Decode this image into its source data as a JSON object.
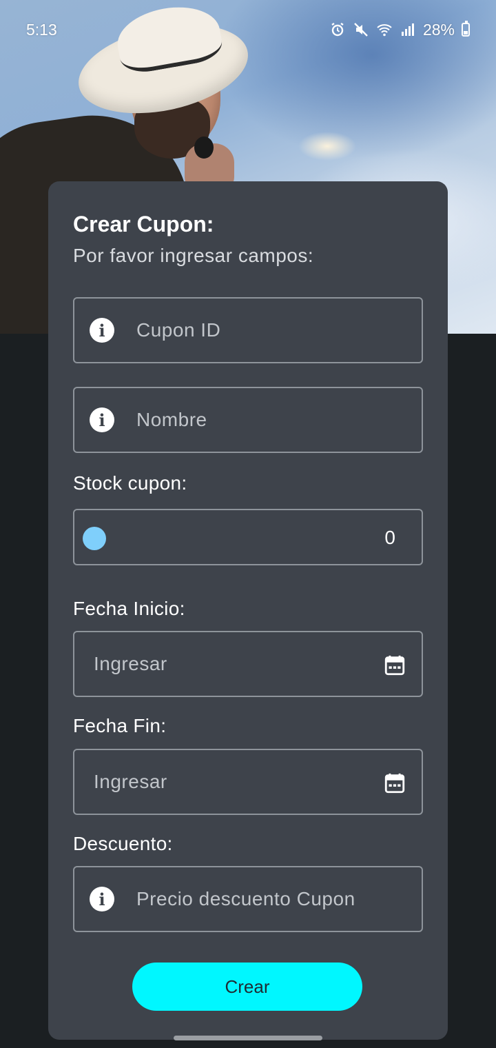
{
  "status_bar": {
    "time": "5:13",
    "battery": "28%",
    "icons": [
      "alarm-icon",
      "mute-icon",
      "wifi-icon",
      "signal-icon",
      "battery-icon"
    ]
  },
  "hero": {
    "image": "performer-photo"
  },
  "form": {
    "title": "Crear Cupon:",
    "subtitle": "Por favor ingresar campos:",
    "coupon_id": {
      "placeholder": "Cupon ID",
      "icon": "info-icon"
    },
    "name": {
      "placeholder": "Nombre",
      "icon": "info-icon"
    },
    "stock": {
      "label": "Stock cupon:",
      "value": "0"
    },
    "start_date": {
      "label": "Fecha Inicio:",
      "placeholder": "Ingresar",
      "icon": "calendar-icon"
    },
    "end_date": {
      "label": "Fecha Fin:",
      "placeholder": "Ingresar",
      "icon": "calendar-icon"
    },
    "discount": {
      "label": "Descuento:",
      "placeholder": "Precio descuento Cupon",
      "icon": "info-icon"
    },
    "submit_label": "Crear"
  },
  "colors": {
    "card_bg": "#3e434b",
    "page_bg": "#1b1f22",
    "accent_button": "#00f7ff",
    "slider_thumb": "#7fcffb",
    "field_border": "#8e949b"
  }
}
